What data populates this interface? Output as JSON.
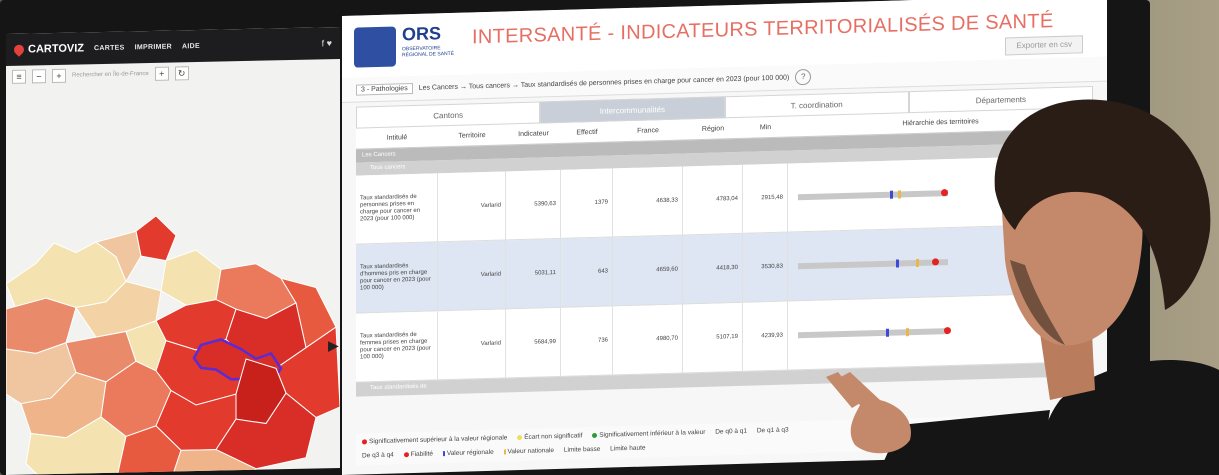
{
  "cartoviz": {
    "brand": "CARTOVIZ",
    "nav": [
      "CARTES",
      "IMPRIMER",
      "AIDE"
    ],
    "social": "f  ♥",
    "search_placeholder": "Rechercher en Île-de-France"
  },
  "ors": {
    "logo_text": "ORS",
    "logo_sub": "OBSERVATOIRE RÉGIONAL DE SANTÉ",
    "title": "INTERSANTÉ - INDICATEURS TERRITORIALISÉS DE SANTÉ",
    "export_label": "Exporter en csv",
    "filter_select": "3 - Pathologies",
    "breadcrumb": "Les Cancers → Tous cancers → Taux standardisés de personnes prises en charge pour cancer en 2023 (pour 100 000)",
    "help": "?",
    "tabs": [
      "Cantons",
      "Intercommunalités",
      "T. coordination",
      "Départements"
    ],
    "columns": [
      "Intitulé",
      "Territoire",
      "Indicateur",
      "Effectif",
      "France",
      "Région",
      "Min",
      "Hiérarchie des territoires"
    ],
    "group_label": "Les Cancers",
    "subgroup_label": "Tous cancers",
    "rows": [
      {
        "label": "Taux standardisés de personnes prises en charge pour cancer en 2023 (pour 100 000)",
        "territory": "Varlarid",
        "indicator": "5390,63",
        "count": "1379",
        "france": "4638,33",
        "region": "4783,04",
        "min": "2915,48"
      },
      {
        "label": "Taux standardisés d'hommes pris en charge pour cancer en 2023 (pour 100 000)",
        "territory": "Varlarid",
        "indicator": "5031,11",
        "count": "643",
        "france": "4659,60",
        "region": "4418,30",
        "min": "3530,83"
      },
      {
        "label": "Taux standardisés de femmes prises en charge pour cancer en 2023 (pour 100 000)",
        "territory": "Varlarid",
        "indicator": "5684,99",
        "count": "736",
        "france": "4980,70",
        "region": "5107,19",
        "min": "4239,93"
      }
    ],
    "last_row_label": "Taux standardisés de",
    "legend": {
      "sup": "Significativement supérieur à la valeur régionale",
      "ns": "Écart non significatif",
      "inf": "Significativement inférieur à la valeur",
      "q1": "De q0 à q1",
      "q3": "De q1 à q3",
      "q4": "De q3 à q4",
      "fiab": "Fiabilité",
      "vreg": "Valeur régionale",
      "vnat": "Valeur nationale",
      "lb": "Limite basse",
      "lh": "Limite haute"
    }
  },
  "colors": {
    "title_accent": "#e66f63",
    "ors_blue": "#2f4fa2",
    "significant_red": "#e52222",
    "non_sig_yellow": "#e8b84a",
    "significant_green": "#2e9b3a"
  }
}
